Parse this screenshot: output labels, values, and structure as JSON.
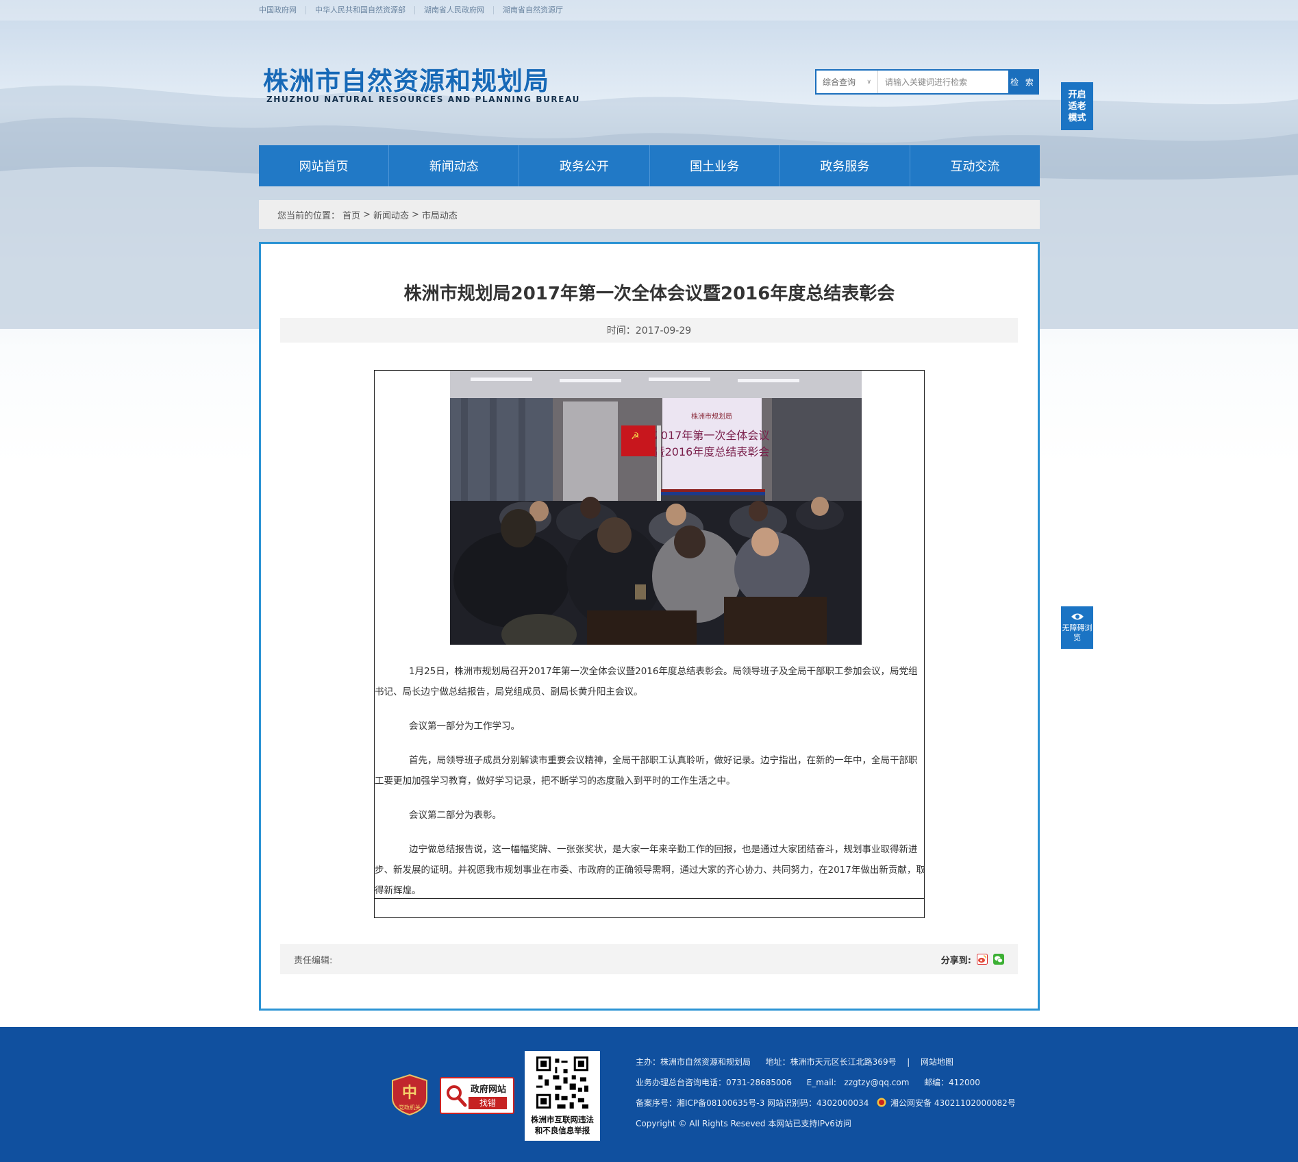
{
  "top_links": [
    "中国政府网",
    "中华人民共和国自然资源部",
    "湖南省人民政府网",
    "湖南省自然资源厅"
  ],
  "logo": {
    "cn": "株洲市自然资源和规划局",
    "en": "ZHUZHOU NATURAL RESOURCES AND PLANNING BUREAU"
  },
  "search": {
    "scope": "综合查询",
    "placeholder": "请输入关键词进行检索",
    "button": "检 索"
  },
  "elder_mode": "开启适老模式",
  "accessibility": "无障碍浏览",
  "nav": [
    "网站首页",
    "新闻动态",
    "政务公开",
    "国土业务",
    "政务服务",
    "互动交流"
  ],
  "breadcrumb": {
    "prefix": "您当前的位置：",
    "items": [
      "首页",
      "新闻动态",
      "市局动态"
    ],
    "separator": ">"
  },
  "article": {
    "title": "株洲市规划局2017年第一次全体会议暨2016年度总结表彰会",
    "date": "时间：2017-09-29",
    "photo_slide": {
      "line1": "株洲市规划局",
      "line2": "2017年第一次全体会议",
      "line3": "暨2016年度总结表彰会"
    },
    "paragraphs": [
      "1月25日，株洲市规划局召开2017年第一次全体会议暨2016年度总结表彰会。局领导班子及全局干部职工参加会议，局党组书记、局长边宁做总结报告，局党组成员、副局长黄升阳主会议。",
      "会议第一部分为工作学习。",
      "首先，局领导班子成员分别解读市重要会议精神，全局干部职工认真聆听，做好记录。边宁指出，在新的一年中，全局干部职工要更加加强学习教育，做好学习记录，把不断学习的态度融入到平时的工作生活之中。",
      "会议第二部分为表彰。",
      "边宁做总结报告说，这一幅幅奖牌、一张张奖状，是大家一年来辛勤工作的回报，也是通过大家团结奋斗，规划事业取得新进步、新发展的证明。并祝愿我市规划事业在市委、市政府的正确领导需啊，通过大家的齐心协力、共同努力，在2017年做出新贡献，取得新辉煌。"
    ],
    "editor": "责任编辑:",
    "share_label": "分享到:"
  },
  "footer": {
    "badge_party": "党政机关",
    "badge_gov": {
      "line1": "政府网站",
      "line2": "找错"
    },
    "qr_caption": {
      "line1": "株洲市互联网违法",
      "line2": "和不良信息举报"
    },
    "line1": {
      "host": "主办：株洲市自然资源和规划局",
      "address": "地址：株洲市天元区长江北路369号",
      "sep": "|",
      "sitemap": "网站地图"
    },
    "line2": {
      "phone": "业务办理总台咨询电话：0731-28685006",
      "email": "E_mail:   zzgtzy@qq.com",
      "zip": "邮编：412000"
    },
    "line3": {
      "icp": "备案序号：湘ICP备08100635号-3 网站识别码：4302000034",
      "police": "湘公网安备 43021102000082号"
    },
    "line4": "Copyright © All Rights Reseved 本网站已支持IPv6访问"
  }
}
